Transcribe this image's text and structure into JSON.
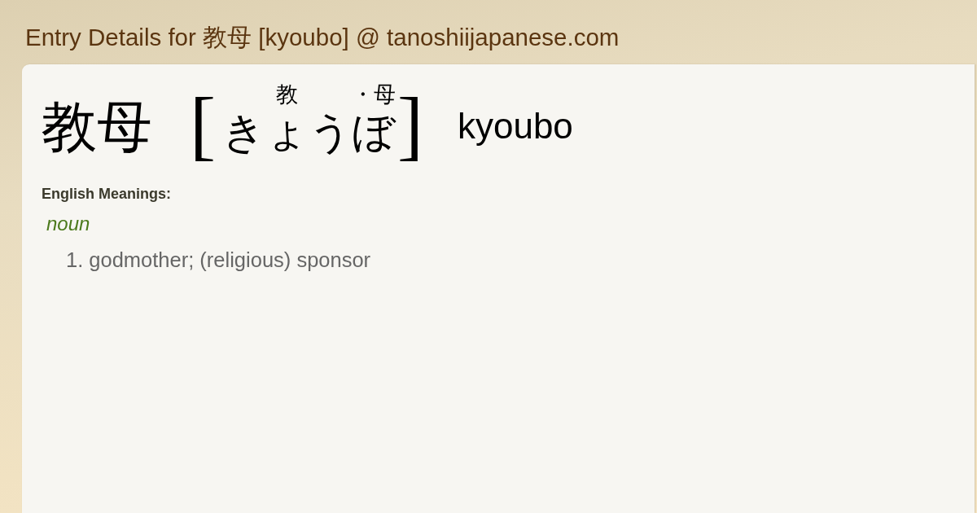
{
  "page_title": "Entry Details for 教母 [kyoubo] @ tanoshiijapanese.com",
  "entry": {
    "headword": "教母",
    "reading": {
      "open_bracket": "[",
      "segments": [
        {
          "kanji": "教",
          "kana": "きょう"
        },
        {
          "kanji": "・母",
          "kana": "ぼ"
        }
      ],
      "close_bracket": "]"
    },
    "romaji": "kyoubo"
  },
  "meanings_heading": "English Meanings:",
  "senses": [
    {
      "part_of_speech": "noun",
      "definitions": [
        {
          "number": "1.",
          "text": "godmother; (religious) sponsor"
        }
      ]
    }
  ]
}
